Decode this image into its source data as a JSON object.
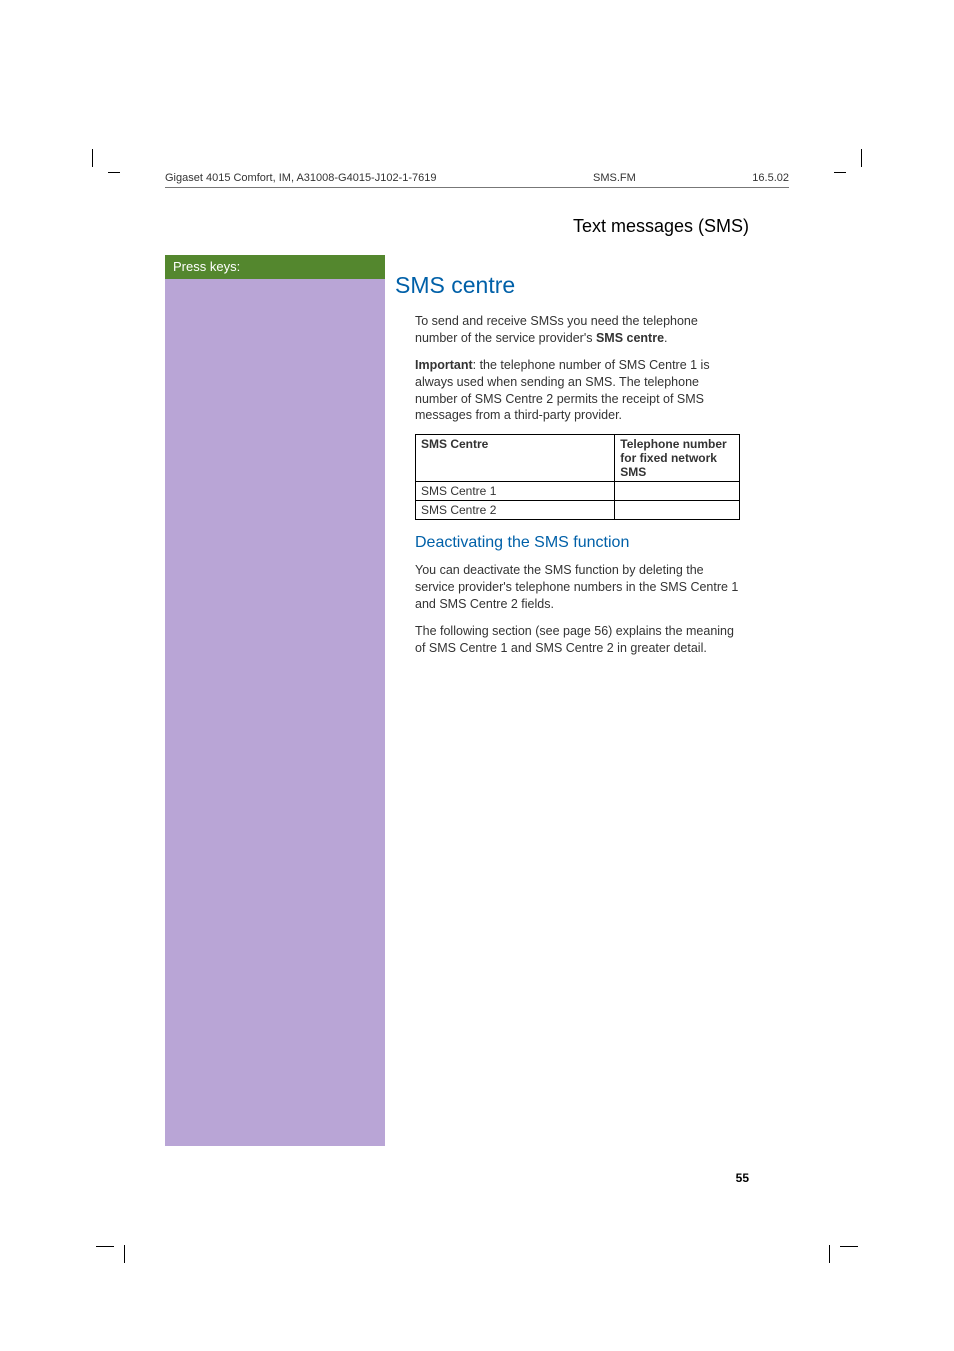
{
  "header": {
    "doc_id": "Gigaset 4015 Comfort, IM, A31008-G4015-J102-1-7619",
    "file": "SMS.FM",
    "date": "16.5.02"
  },
  "section_title": "Text messages (SMS)",
  "press_keys_label": "Press keys:",
  "main": {
    "heading": "SMS centre",
    "para1_pre": "To send and receive SMSs you need the telephone number of the service provider's ",
    "para1_bold": "SMS centre",
    "para1_post": ".",
    "para2_bold": "Important",
    "para2_text": ": the telephone number of SMS Centre 1 is always used when sending an SMS. The telephone number of SMS Centre 2 permits the receipt of SMS messages from a third-party provider.",
    "table": {
      "col1_header": "SMS Centre",
      "col2_header": "Telephone number for fixed network SMS",
      "rows": [
        {
          "c1": "SMS Centre 1",
          "c2": ""
        },
        {
          "c1": "SMS Centre 2",
          "c2": ""
        }
      ]
    },
    "sub_heading": "Deactivating the SMS function",
    "para3": "You can deactivate the SMS function by deleting the service provider's telephone numbers in the SMS Centre 1 and SMS Centre 2 fields.",
    "para4": "The following section (see  page 56) explains the meaning of SMS Centre 1 and SMS Centre 2 in greater detail."
  },
  "page_number": "55"
}
